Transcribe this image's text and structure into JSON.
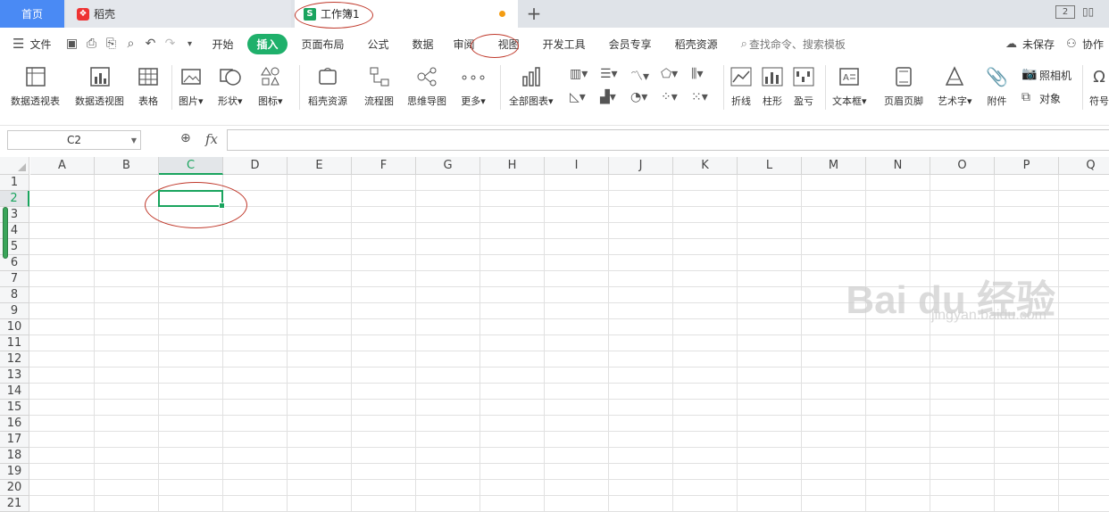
{
  "tabs": {
    "home": "首页",
    "daoke": "稻壳",
    "workbook": "工作簿1",
    "new_tab": "+"
  },
  "window": {
    "layout_badge": "2"
  },
  "menu": {
    "file": "文件",
    "items": [
      "开始",
      "插入",
      "页面布局",
      "公式",
      "数据",
      "审阅",
      "视图",
      "开发工具",
      "会员专享",
      "稻壳资源"
    ],
    "active": "插入",
    "search": "查找命令、搜索模板",
    "unsaved": "未保存",
    "collab": "协作"
  },
  "ribbon": {
    "pivot_table": "数据透视表",
    "pivot_chart": "数据透视图",
    "table": "表格",
    "picture": "图片",
    "shape": "形状",
    "icon": "图标",
    "daoke_res": "稻壳资源",
    "flowchart": "流程图",
    "mindmap": "思维导图",
    "more": "更多",
    "all_charts": "全部图表",
    "line": "折线",
    "column": "柱形",
    "winloss": "盈亏",
    "textbox": "文本框",
    "header_footer": "页眉页脚",
    "wordart": "艺术字",
    "attachment": "附件",
    "camera": "照相机",
    "object": "对象",
    "symbol": "符号"
  },
  "formula_bar": {
    "name_box": "C2",
    "fx": "fx",
    "value": ""
  },
  "sheet": {
    "columns": [
      "A",
      "B",
      "C",
      "D",
      "E",
      "F",
      "G",
      "H",
      "I",
      "J",
      "K",
      "L",
      "M",
      "N",
      "O",
      "P",
      "Q"
    ],
    "rows": [
      "1",
      "2",
      "3",
      "4",
      "5",
      "6",
      "7",
      "8",
      "9",
      "10",
      "11",
      "12",
      "13",
      "14",
      "15",
      "16",
      "17",
      "18",
      "19",
      "20",
      "21"
    ],
    "selected_col": "C",
    "selected_row": "2"
  },
  "watermark": {
    "logo": "Bai du 经验",
    "url": "jingyan.baidu.com"
  },
  "colors": {
    "accent": "#1aa45e",
    "home_tab": "#4a8af4",
    "annotation": "#c0392b"
  }
}
